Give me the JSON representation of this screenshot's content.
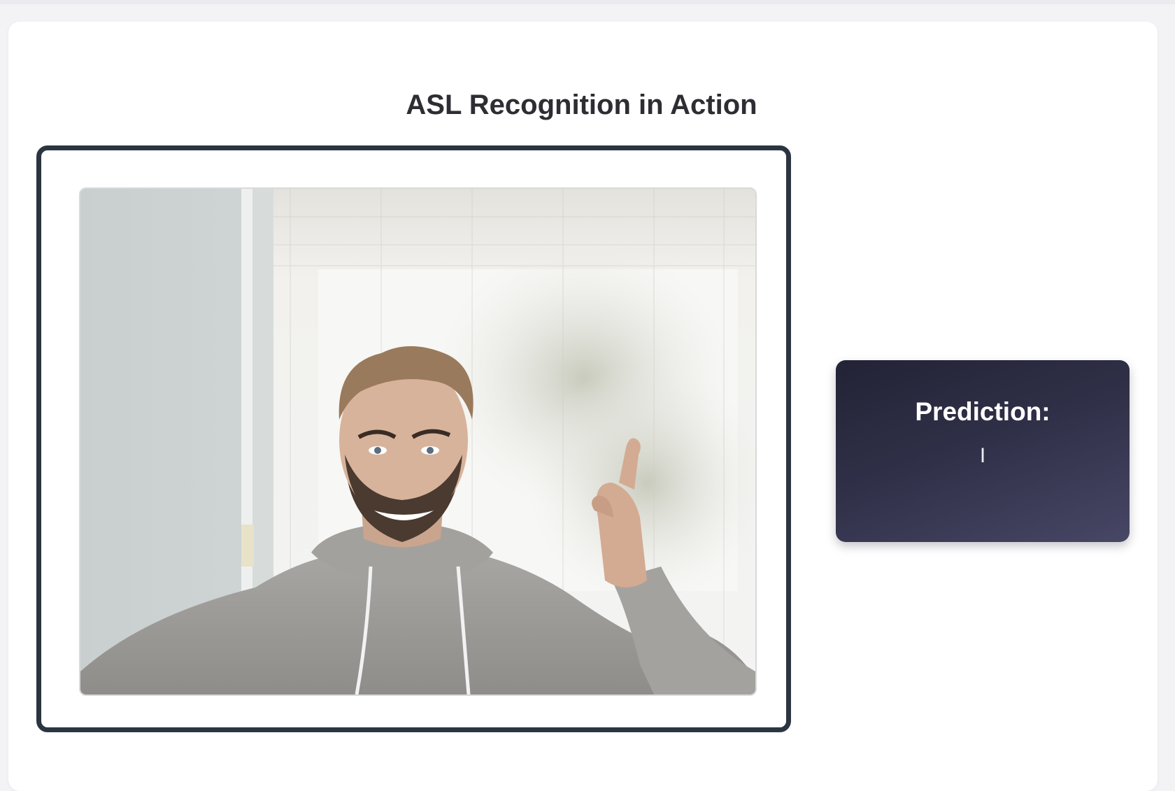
{
  "page": {
    "title": "ASL Recognition in Action"
  },
  "video": {
    "subject": "webcam feed: person raising index finger"
  },
  "prediction": {
    "label": "Prediction:",
    "value": "I"
  },
  "colors": {
    "frame_border": "#2b3542",
    "prediction_bg_start": "#232336",
    "prediction_bg_end": "#474766",
    "title_text": "#2d2d33"
  }
}
